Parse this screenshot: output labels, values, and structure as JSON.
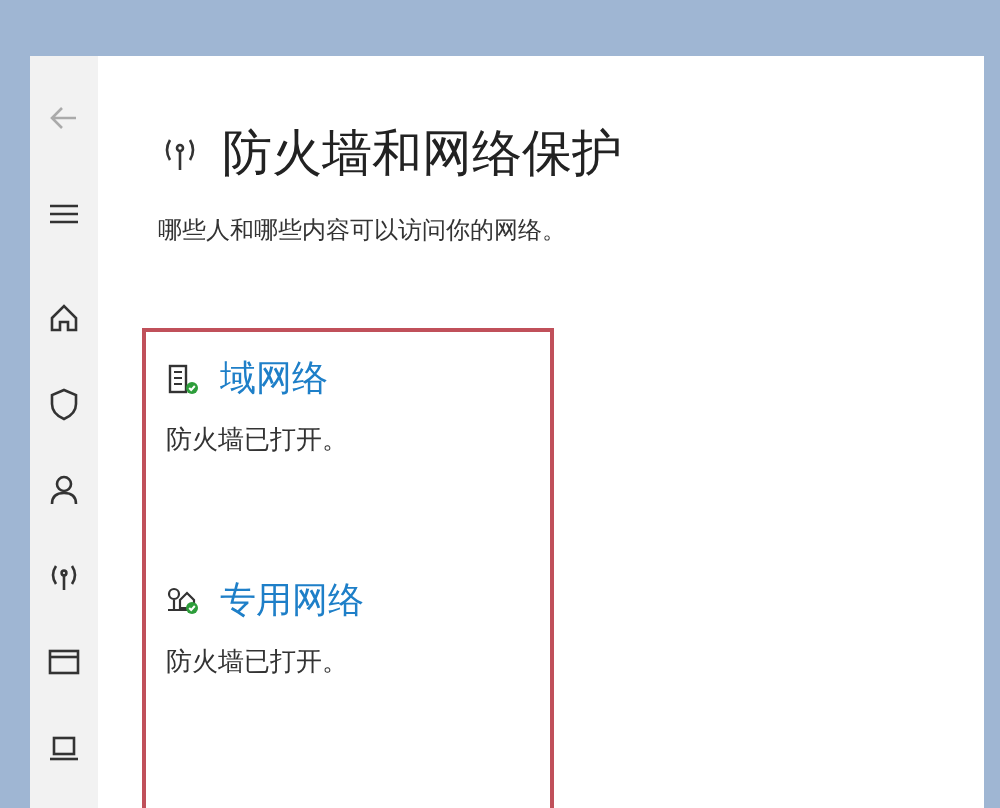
{
  "back_button": {
    "disabled": true
  },
  "sidebar": {
    "items": [
      {
        "kind": "home"
      },
      {
        "kind": "shield"
      },
      {
        "kind": "person"
      },
      {
        "kind": "antenna"
      },
      {
        "kind": "window"
      },
      {
        "kind": "laptop"
      }
    ]
  },
  "page": {
    "title": "防火墙和网络保护",
    "subtitle": "哪些人和哪些内容可以访问你的网络。"
  },
  "networks": [
    {
      "kind": "domain",
      "name": "域网络",
      "status": "防火墙已打开。",
      "on": true
    },
    {
      "kind": "private",
      "name": "专用网络",
      "status": "防火墙已打开。",
      "on": true
    }
  ]
}
